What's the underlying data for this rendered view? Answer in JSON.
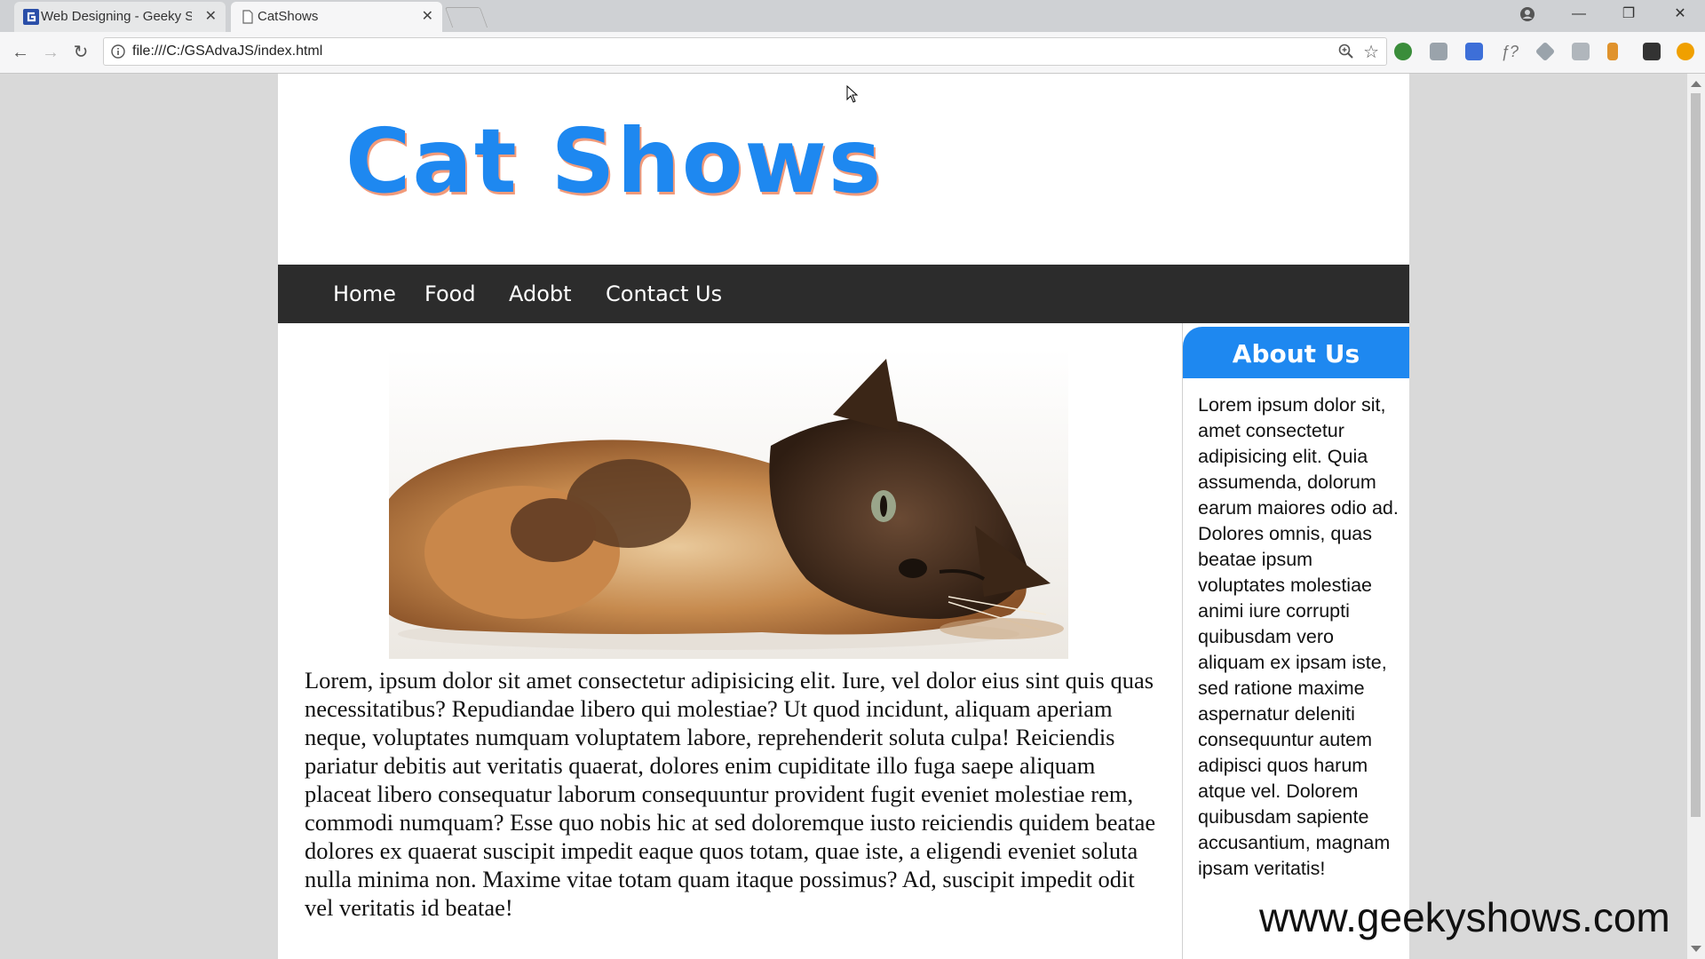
{
  "browser": {
    "tabs": [
      {
        "title": "Web Designing - Geeky S",
        "active": false
      },
      {
        "title": "CatShows",
        "active": true
      }
    ],
    "url": "file:///C:/GSAdvaJS/index.html"
  },
  "site": {
    "title": "Cat Shows",
    "nav": [
      "Home",
      "Food",
      "Adobt",
      "Contact Us"
    ],
    "main_text": "Lorem, ipsum dolor sit amet consectetur adipisicing elit. Iure, vel dolor eius sint quis quas necessitatibus? Repudiandae libero qui molestiae? Ut quod incidunt, aliquam aperiam neque, voluptates numquam voluptatem labore, reprehenderit soluta culpa! Reiciendis pariatur debitis aut veritatis quaerat, dolores enim cupiditate illo fuga saepe aliquam placeat libero consequatur laborum consequuntur provident fugit eveniet molestiae rem, commodi numquam? Esse quo nobis hic at sed doloremque iusto reiciendis quidem beatae dolores ex quaerat suscipit impedit eaque quos totam, quae iste, a eligendi eveniet soluta nulla minima non. Maxime vitae totam quam itaque possimus? Ad, suscipit impedit odit vel veritatis id beatae!",
    "aside": {
      "heading": "About Us",
      "text": "Lorem ipsum dolor sit, amet consectetur adipisicing elit. Quia assumenda, dolorum earum maiores odio ad. Dolores omnis, quas beatae ipsum voluptates molestiae animi iure corrupti quibusdam vero aliquam ex ipsam iste, sed ratione maxime aspernatur deleniti consequuntur autem adipisci quos harum atque vel. Dolorem quibusdam sapiente accusantium, magnam ipsam veritatis!"
    }
  },
  "watermark": "www.geekyshows.com",
  "colors": {
    "brand_blue": "#1e88f0",
    "navbar": "#2c2c2c",
    "title_shadow": "#f19a7a"
  },
  "icons": [
    "geekyshows-favicon",
    "page-icon",
    "close-icon",
    "back-icon",
    "forward-icon",
    "reload-icon",
    "info-icon",
    "zoom-icon",
    "star-icon",
    "profile-icon",
    "minimize-icon",
    "maximize-icon"
  ]
}
